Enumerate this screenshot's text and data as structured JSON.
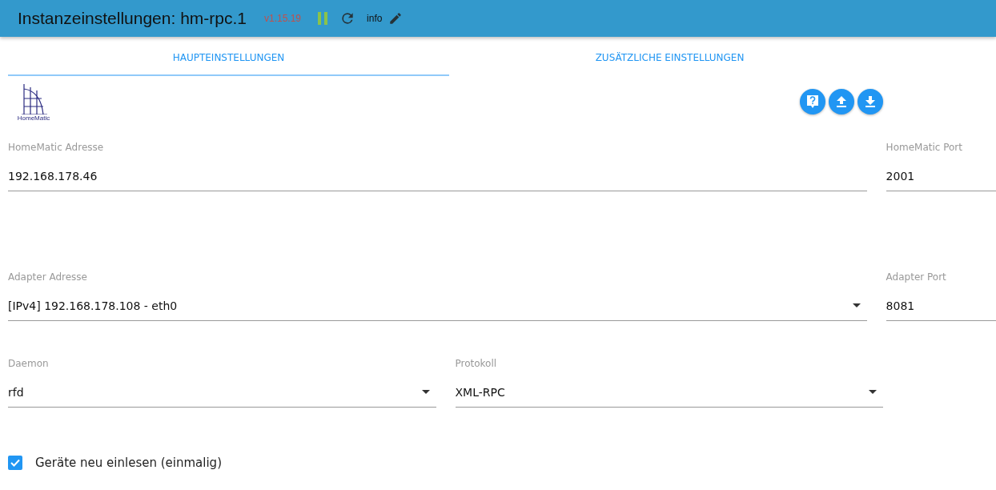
{
  "header": {
    "title": "Instanzeinstellungen: hm-rpc.1",
    "version": "v1.15.19",
    "info": "info"
  },
  "tabs": [
    {
      "label": "HAUPTEINSTELLUNGEN",
      "selected": true
    },
    {
      "label": "ZUSÄTZLICHE EINSTELLUNGEN",
      "selected": false
    }
  ],
  "logo_text": "HomeMatic",
  "rows": [
    {
      "kind": "main-side",
      "fields": [
        {
          "kind": "text",
          "label": "HomeMatic Adresse",
          "value": "192.168.178.46"
        },
        {
          "kind": "text",
          "label": "HomeMatic Port",
          "value": "2001"
        }
      ]
    },
    {
      "kind": "main-side",
      "fields": [
        {
          "kind": "select",
          "label": "Adapter Adresse",
          "value": "[IPv4] 192.168.178.108 - eth0"
        },
        {
          "kind": "text",
          "label": "Adapter Port",
          "value": "8081"
        }
      ]
    },
    {
      "kind": "pair",
      "fields": [
        {
          "kind": "select",
          "label": "Daemon",
          "value": "rfd"
        },
        {
          "kind": "select",
          "label": "Protokoll",
          "value": "XML-RPC"
        }
      ]
    }
  ],
  "checkbox": {
    "label": "Geräte neu einlesen (einmalig)",
    "checked": true
  }
}
